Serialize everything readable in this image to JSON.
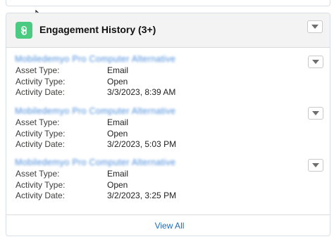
{
  "card": {
    "title": "Engagement History (3+)",
    "accent": "#4bca81",
    "footer_link": "View All"
  },
  "engagements": [
    {
      "asset_name": "Mobiledemyo Pro Computer Alternative",
      "fields": [
        {
          "label": "Asset Type:",
          "value": "Email"
        },
        {
          "label": "Activity Type:",
          "value": "Open"
        },
        {
          "label": "Activity Date:",
          "value": "3/3/2023, 8:39 AM"
        }
      ]
    },
    {
      "asset_name": "Mobiledemyo Pro Computer Alternative",
      "fields": [
        {
          "label": "Asset Type:",
          "value": "Email"
        },
        {
          "label": "Activity Type:",
          "value": "Open"
        },
        {
          "label": "Activity Date:",
          "value": "3/2/2023, 5:03 PM"
        }
      ]
    },
    {
      "asset_name": "Mobiledemyo Pro Computer Alternative",
      "fields": [
        {
          "label": "Asset Type:",
          "value": "Email"
        },
        {
          "label": "Activity Type:",
          "value": "Open"
        },
        {
          "label": "Activity Date:",
          "value": "3/2/2023, 3:25 PM"
        }
      ]
    }
  ]
}
